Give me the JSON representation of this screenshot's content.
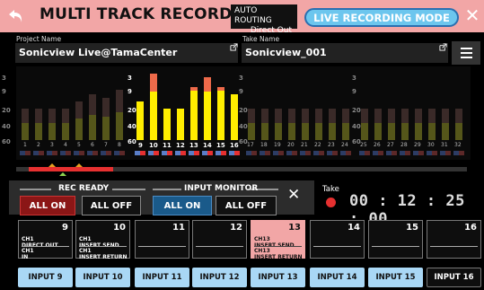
{
  "header": {
    "title": "MULTI TRACK RECORDER",
    "routing_line1": "AUTO ROUTING",
    "routing_line2": "Direct Out",
    "mode": "LIVE RECORDING MODE",
    "close": "✕"
  },
  "project": {
    "label": "Project Name",
    "value": "Sonicview Live@TamaCenter"
  },
  "take": {
    "label": "Take Name",
    "value": "Sonicview_001"
  },
  "meters": {
    "scale": [
      "3",
      "9",
      "20",
      "40",
      "60"
    ],
    "channels": [
      "1",
      "2",
      "3",
      "4",
      "5",
      "6",
      "7",
      "8",
      "9",
      "10",
      "11",
      "12",
      "13",
      "14",
      "15",
      "16",
      "17",
      "18",
      "19",
      "20",
      "21",
      "22",
      "23",
      "24",
      "25",
      "26",
      "27",
      "28",
      "29",
      "30",
      "31",
      "32"
    ],
    "levels": [
      0.45,
      0.45,
      0.45,
      0.45,
      0.55,
      0.65,
      0.6,
      0.72,
      0.55,
      0.95,
      0.45,
      0.45,
      0.75,
      0.9,
      0.75,
      0.65,
      0.45,
      0.45,
      0.45,
      0.45,
      0.45,
      0.45,
      0.45,
      0.45,
      0.45,
      0.45,
      0.45,
      0.45,
      0.45,
      0.45,
      0.45,
      0.45
    ]
  },
  "controls": {
    "rec_ready": "REC READY",
    "all_on": "ALL ON",
    "all_off": "ALL OFF",
    "input_monitor": "INPUT MONITOR",
    "mon_all_on": "ALL ON",
    "mon_all_off": "ALL OFF",
    "close": "✕"
  },
  "take_panel": {
    "label": "Take",
    "timecode": "00 : 12 : 25 : 00"
  },
  "slots": [
    {
      "num": "9",
      "l1a": "CH1",
      "l1b": "DIRECT OUT",
      "l2a": "CH1",
      "l2b": "IN"
    },
    {
      "num": "10",
      "l1a": "CH1",
      "l1b": "INSERT SEND",
      "l2a": "CH1",
      "l2b": "INSERT RETURN"
    },
    {
      "num": "11",
      "l1a": "",
      "l1b": "",
      "l2a": "",
      "l2b": ""
    },
    {
      "num": "12",
      "l1a": "",
      "l1b": "",
      "l2a": "",
      "l2b": ""
    },
    {
      "num": "13",
      "l1a": "CH13",
      "l1b": "INSERT SEND",
      "l2a": "CH13",
      "l2b": "INSERT RETURN"
    },
    {
      "num": "14",
      "l1a": "",
      "l1b": "",
      "l2a": "",
      "l2b": ""
    },
    {
      "num": "15",
      "l1a": "",
      "l1b": "",
      "l2a": "",
      "l2b": ""
    },
    {
      "num": "16",
      "l1a": "",
      "l1b": "",
      "l2a": "",
      "l2b": ""
    }
  ],
  "inputs": [
    "INPUT 9",
    "INPUT 10",
    "INPUT 11",
    "INPUT 12",
    "INPUT 13",
    "INPUT 14",
    "INPUT 15",
    "INPUT 16"
  ],
  "colors": {
    "accent": "#f2a6a6",
    "mode": "#6cc6ee",
    "rec": "#e63030",
    "input": "#a9d7f5",
    "meter_active": "#ffee00"
  }
}
